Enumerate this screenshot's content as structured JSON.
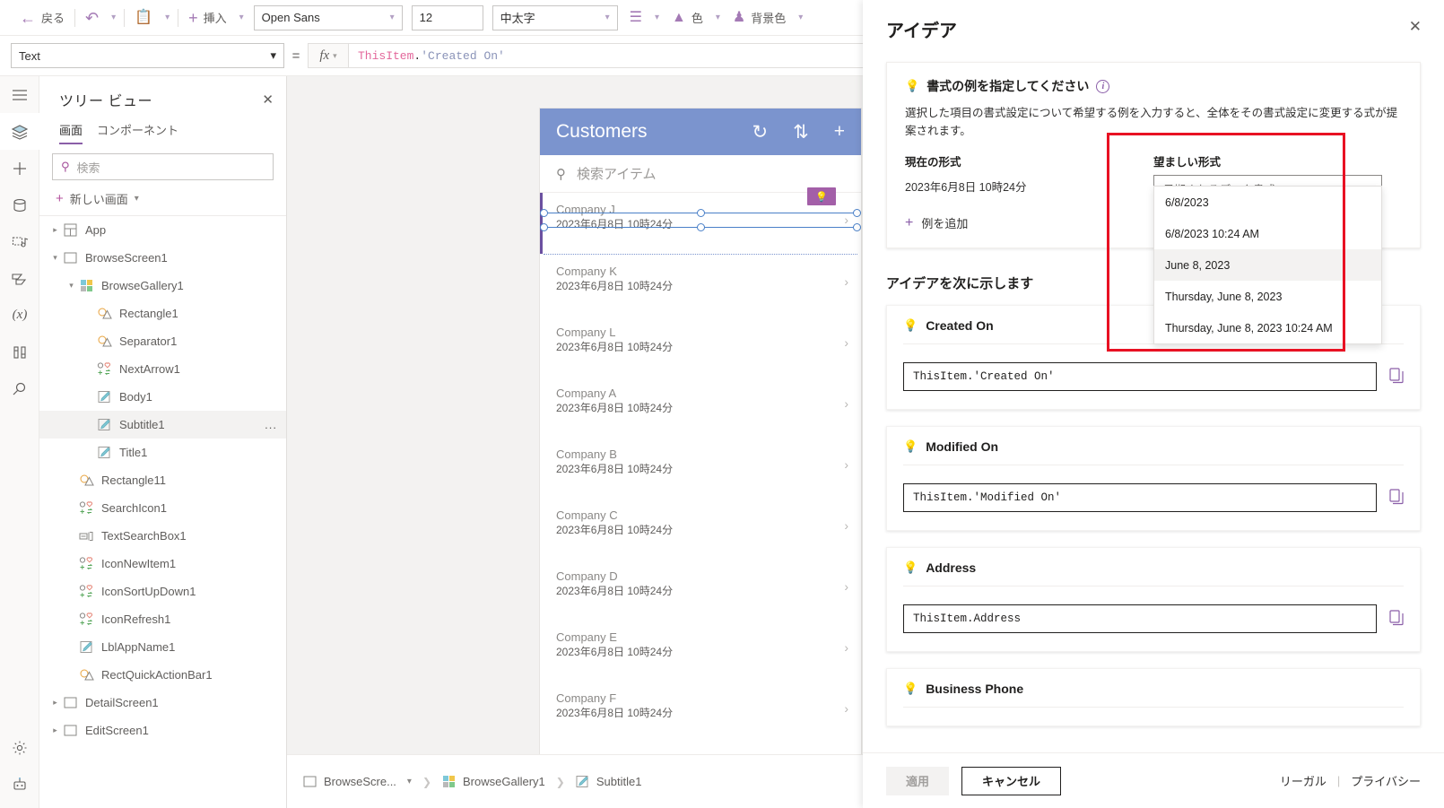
{
  "commandbar": {
    "back_label": "戻る",
    "undo_icon": "undo-icon",
    "paste_icon": "paste-icon",
    "insert_label": "挿入",
    "font_value": "Open Sans",
    "size_value": "12",
    "weight_value": "中太字",
    "align_icon": "align-icon",
    "color_label": "色",
    "fill_label": "背景色"
  },
  "propertybar": {
    "property_value": "Text",
    "equals": "=",
    "fx_label": "fx",
    "formula_object": "ThisItem",
    "formula_dot": ".",
    "formula_string": "'Created On'"
  },
  "rail": {
    "items": [
      {
        "name": "hamburger-icon"
      },
      {
        "name": "tree-view-icon"
      },
      {
        "name": "insert-icon"
      },
      {
        "name": "data-icon"
      },
      {
        "name": "media-icon"
      },
      {
        "name": "power-automate-icon"
      },
      {
        "name": "variables-icon"
      },
      {
        "name": "tools-icon"
      },
      {
        "name": "search-icon"
      }
    ],
    "bottom": [
      {
        "name": "settings-icon"
      },
      {
        "name": "copilot-icon"
      }
    ]
  },
  "treeview": {
    "title": "ツリー ビュー",
    "tabs": [
      {
        "label": "画面",
        "active": true
      },
      {
        "label": "コンポーネント",
        "active": false
      }
    ],
    "search_placeholder": "検索",
    "new_screen_label": "新しい画面",
    "items": [
      {
        "label": "App",
        "indent": 0,
        "caret": "collapsed",
        "icon": "app-icon"
      },
      {
        "label": "BrowseScreen1",
        "indent": 0,
        "caret": "expanded",
        "icon": "screen-icon"
      },
      {
        "label": "BrowseGallery1",
        "indent": 1,
        "caret": "expanded",
        "icon": "gallery-icon"
      },
      {
        "label": "Rectangle1",
        "indent": 2,
        "caret": "none",
        "icon": "shape-icon"
      },
      {
        "label": "Separator1",
        "indent": 2,
        "caret": "none",
        "icon": "shape-icon"
      },
      {
        "label": "NextArrow1",
        "indent": 2,
        "caret": "none",
        "icon": "control-icon"
      },
      {
        "label": "Body1",
        "indent": 2,
        "caret": "none",
        "icon": "label-icon"
      },
      {
        "label": "Subtitle1",
        "indent": 2,
        "caret": "none",
        "icon": "label-icon",
        "selected": true,
        "overflow": "..."
      },
      {
        "label": "Title1",
        "indent": 2,
        "caret": "none",
        "icon": "label-icon"
      },
      {
        "label": "Rectangle11",
        "indent": 1,
        "caret": "none",
        "icon": "shape-icon"
      },
      {
        "label": "SearchIcon1",
        "indent": 1,
        "caret": "none",
        "icon": "control-icon"
      },
      {
        "label": "TextSearchBox1",
        "indent": 1,
        "caret": "none",
        "icon": "textinput-icon"
      },
      {
        "label": "IconNewItem1",
        "indent": 1,
        "caret": "none",
        "icon": "control-icon"
      },
      {
        "label": "IconSortUpDown1",
        "indent": 1,
        "caret": "none",
        "icon": "control-icon"
      },
      {
        "label": "IconRefresh1",
        "indent": 1,
        "caret": "none",
        "icon": "control-icon"
      },
      {
        "label": "LblAppName1",
        "indent": 1,
        "caret": "none",
        "icon": "label-icon"
      },
      {
        "label": "RectQuickActionBar1",
        "indent": 1,
        "caret": "none",
        "icon": "shape-icon"
      },
      {
        "label": "DetailScreen1",
        "indent": 0,
        "caret": "collapsed",
        "icon": "screen-icon"
      },
      {
        "label": "EditScreen1",
        "indent": 0,
        "caret": "collapsed",
        "icon": "screen-icon"
      }
    ]
  },
  "canvas": {
    "app_title": "Customers",
    "refresh_icon": "refresh-icon",
    "sort_icon": "sort-updown-icon",
    "new_icon": "plus-icon",
    "search_placeholder": "検索アイテム",
    "badge_icon": "lightbulb-icon",
    "gallery": [
      {
        "title": "Company J",
        "subtitle": "2023年6月8日 10時24分",
        "selected": true
      },
      {
        "title": "Company K",
        "subtitle": "2023年6月8日 10時24分"
      },
      {
        "title": "Company L",
        "subtitle": "2023年6月8日 10時24分"
      },
      {
        "title": "Company A",
        "subtitle": "2023年6月8日 10時24分"
      },
      {
        "title": "Company B",
        "subtitle": "2023年6月8日 10時24分"
      },
      {
        "title": "Company C",
        "subtitle": "2023年6月8日 10時24分"
      },
      {
        "title": "Company D",
        "subtitle": "2023年6月8日 10時24分"
      },
      {
        "title": "Company E",
        "subtitle": "2023年6月8日 10時24分"
      },
      {
        "title": "Company F",
        "subtitle": "2023年6月8日 10時24分"
      }
    ]
  },
  "statusbar": {
    "crumbs": [
      {
        "label": "BrowseScre...",
        "icon": "screen-icon",
        "caret": true
      },
      {
        "label": "BrowseGallery1",
        "icon": "gallery-icon",
        "caret": false
      },
      {
        "label": "Subtitle1",
        "icon": "label-icon",
        "caret": false
      }
    ]
  },
  "ideas": {
    "title": "アイデア",
    "close_icon": "close-icon",
    "format_card": {
      "heading": "書式の例を指定してください",
      "bulb_icon": "lightbulb-icon",
      "info_icon": "info-icon",
      "description": "選択した項目の書式設定について希望する例を入力すると、全体をその書式設定に変更する式が提案されます。",
      "current_label": "現在の形式",
      "current_value": "2023年6月8日 10時24分",
      "desired_label": "望ましい形式",
      "desired_placeholder": "予期されるデータ書式",
      "submit_icon": "arrow-right-icon",
      "add_example_label": "例を追加",
      "dropdown_options": [
        {
          "label": "6/8/2023",
          "highlighted": false
        },
        {
          "label": "6/8/2023 10:24 AM",
          "highlighted": false
        },
        {
          "label": "June 8, 2023",
          "highlighted": true
        },
        {
          "label": "Thursday, June 8, 2023",
          "highlighted": false
        },
        {
          "label": "Thursday, June 8, 2023 10:24 AM",
          "highlighted": false
        }
      ],
      "highlight_color": "#e81123"
    },
    "subheading": "アイデアを次に示します",
    "cards": [
      {
        "title": "Created On",
        "code": "ThisItem.'Created On'",
        "copy_icon": "copy-icon"
      },
      {
        "title": "Modified On",
        "code": "ThisItem.'Modified On'",
        "copy_icon": "copy-icon"
      },
      {
        "title": "Address",
        "code": "ThisItem.Address",
        "copy_icon": "copy-icon"
      },
      {
        "title": "Business Phone",
        "code": "",
        "copy_icon": "copy-icon"
      }
    ],
    "footer": {
      "apply_label": "適用",
      "cancel_label": "キャンセル",
      "legal_label": "リーガル",
      "privacy_label": "プライバシー"
    }
  }
}
